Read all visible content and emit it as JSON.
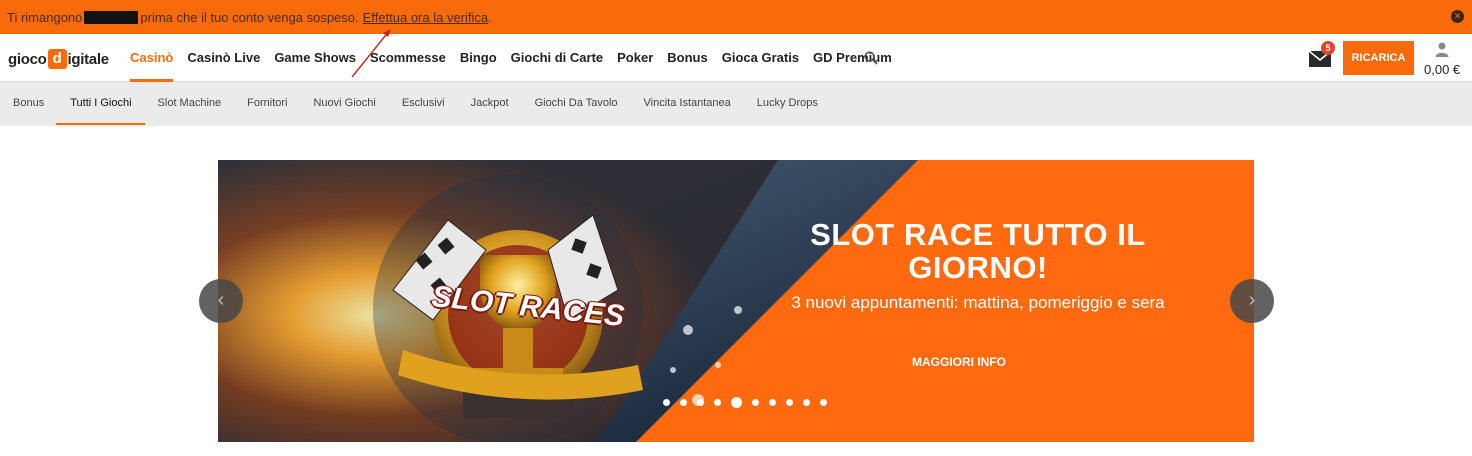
{
  "alert": {
    "text_before": "Ti rimangono",
    "text_after": "prima che il tuo conto venga sospeso.",
    "link": "Effettua ora la verifica",
    "period": "."
  },
  "logo": {
    "part1": "gioco",
    "d": "d",
    "part2": "igitale"
  },
  "nav": {
    "items": [
      {
        "label": "Casinò",
        "active": true
      },
      {
        "label": "Casinò Live"
      },
      {
        "label": "Game Shows"
      },
      {
        "label": "Scommesse"
      },
      {
        "label": "Bingo"
      },
      {
        "label": "Giochi di Carte"
      },
      {
        "label": "Poker"
      },
      {
        "label": "Bonus"
      },
      {
        "label": "Gioca Gratis"
      },
      {
        "label": "GD Premium"
      }
    ]
  },
  "header": {
    "mail_count": "5",
    "ricarica_label": "RICARICA",
    "balance": "0,00 €"
  },
  "subnav": {
    "items": [
      {
        "label": "Bonus"
      },
      {
        "label": "Tutti I Giochi",
        "active": true
      },
      {
        "label": "Slot Machine"
      },
      {
        "label": "Fornitori"
      },
      {
        "label": "Nuovi Giochi"
      },
      {
        "label": "Esclusivi"
      },
      {
        "label": "Jackpot"
      },
      {
        "label": "Giochi Da Tavolo"
      },
      {
        "label": "Vincita Istantanea"
      },
      {
        "label": "Lucky Drops"
      }
    ]
  },
  "banner": {
    "badge": "SLOT RACES",
    "title": "SLOT RACE TUTTO IL GIORNO!",
    "subtitle": "3 nuovi appuntamenti: mattina, pomeriggio e sera",
    "button": "MAGGIORI INFO",
    "dot_count": 10,
    "active_dot": 4
  },
  "colors": {
    "accent": "#f96b0a",
    "alert_text": "#4a2a12"
  }
}
